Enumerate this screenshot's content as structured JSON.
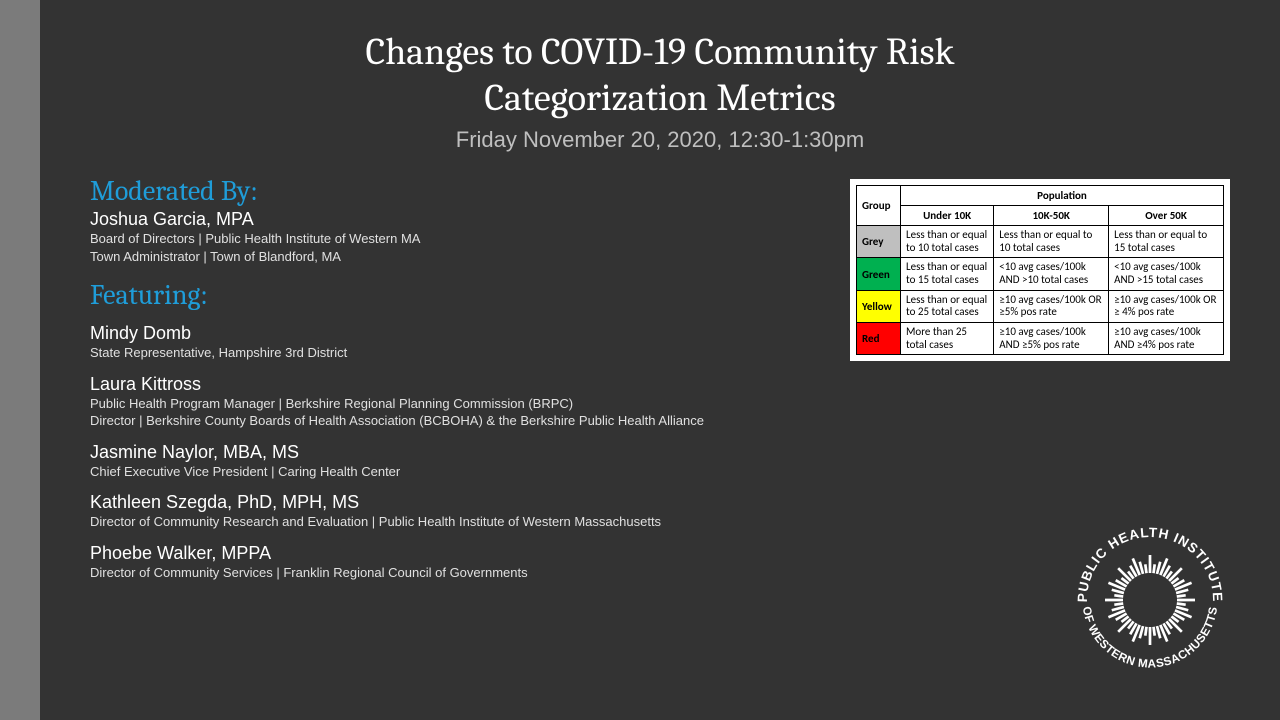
{
  "title_line1": "Changes to COVID-19 Community Risk",
  "title_line2": "Categorization Metrics",
  "subtitle": "Friday November 20, 2020, 12:30-1:30pm",
  "moderated_label": "Moderated By:",
  "moderator": {
    "name": "Joshua Garcia, MPA",
    "role1": "Board of Directors | Public Health Institute of Western MA",
    "role2": "Town Administrator | Town of Blandford, MA"
  },
  "featuring_label": "Featuring:",
  "speakers": [
    {
      "name": "Mindy Domb",
      "role1": "State Representative, Hampshire 3rd District",
      "role2": ""
    },
    {
      "name": "Laura Kittross",
      "role1": "Public Health Program Manager | Berkshire Regional Planning Commission (BRPC)",
      "role2": "Director | Berkshire County Boards of Health Association (BCBOHA) & the Berkshire Public Health Alliance"
    },
    {
      "name": "Jasmine Naylor, MBA, MS",
      "role1": "Chief Executive Vice President | Caring Health Center",
      "role2": ""
    },
    {
      "name": "Kathleen Szegda, PhD, MPH, MS",
      "role1": "Director of Community Research and Evaluation | Public Health Institute of Western Massachusetts",
      "role2": ""
    },
    {
      "name": "Phoebe Walker, MPPA",
      "role1": "Director of Community Services | Franklin Regional Council of Governments",
      "role2": ""
    }
  ],
  "table": {
    "population_header": "Population",
    "group_header": "Group",
    "cols": [
      "Under 10K",
      "10K-50K",
      "Over 50K"
    ],
    "rows": [
      {
        "group": "Grey",
        "bg": "bg-grey",
        "cells": [
          "Less than or equal to 10 total cases",
          "Less than or equal to 10 total cases",
          "Less than or equal to 15 total cases"
        ]
      },
      {
        "group": "Green",
        "bg": "bg-green",
        "cells": [
          "Less than or equal to 15 total cases",
          "<10 avg cases/100k AND >10 total cases",
          "<10 avg cases/100k AND >15 total cases"
        ]
      },
      {
        "group": "Yellow",
        "bg": "bg-yellow",
        "cells": [
          "Less than or equal to 25 total cases",
          "≥10 avg cases/100k OR ≥5% pos rate",
          "≥10 avg cases/100k OR ≥ 4% pos rate"
        ]
      },
      {
        "group": "Red",
        "bg": "bg-red",
        "cells": [
          "More than 25 total cases",
          "≥10 avg cases/100k AND ≥5% pos rate",
          "≥10 avg cases/100k AND ≥4% pos rate"
        ]
      }
    ]
  },
  "logo_text_top": "PUBLIC HEALTH INSTITUTE",
  "logo_text_bottom": "OF WESTERN MASSACHUSETTS"
}
